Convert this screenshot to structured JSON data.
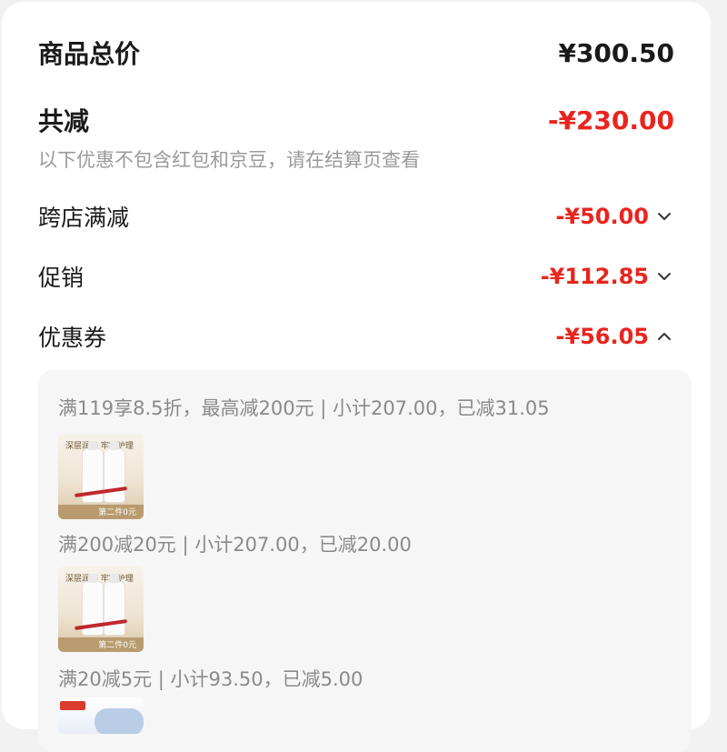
{
  "summary": {
    "total_label": "商品总价",
    "total_value": "¥300.50",
    "reduce_label": "共减",
    "reduce_value": "-¥230.00",
    "note": "以下优惠不包含红包和京豆，请在结算页查看"
  },
  "discounts": [
    {
      "label": "跨店满减",
      "value": "-¥50.00",
      "icon": "chevron-down-icon"
    },
    {
      "label": "促销",
      "value": "-¥112.85",
      "icon": "chevron-down-icon"
    },
    {
      "label": "优惠券",
      "value": "-¥56.05",
      "icon": "chevron-up-icon"
    }
  ],
  "coupon_details": [
    {
      "rule": "满119享8.5折，最高减200元 | 小计207.00，已减31.05"
    },
    {
      "rule": "满200减20元 | 小计207.00，已减20.00"
    },
    {
      "rule": "满20减5元 | 小计93.50，已减5.00"
    }
  ],
  "thumbnail": {
    "headline": "深层润养 牢牢护理",
    "band_text": "第二件0元"
  },
  "colors": {
    "accent_red": "#e8251e",
    "text_dark": "#1a1a1a",
    "text_muted": "#9a9a9a",
    "panel_bg": "#f6f6f6"
  }
}
